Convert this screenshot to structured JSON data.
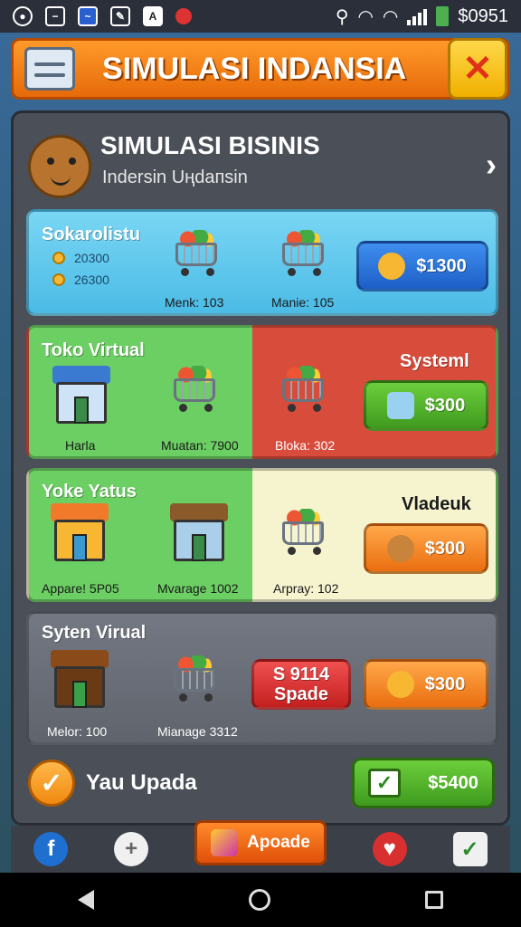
{
  "status": {
    "right_text": "$0951"
  },
  "header": {
    "title": "SIMULASI INDANSIA",
    "close_glyph": "✕"
  },
  "business": {
    "title": "SIMULASI BISINIS",
    "subtitle": "Indersin Uңdaпsin",
    "chevron": "›"
  },
  "cards": [
    {
      "title": "Sokarolistu",
      "values": [
        "20300",
        "26300"
      ],
      "item1_label": "Menk: 103",
      "item2_label": "Manie: 105",
      "price": "$1300"
    },
    {
      "title_left": "Toko Virtual",
      "title_right": "Systeml",
      "item1_label": "Harla",
      "item2_label": "Muatan: 7900",
      "item3_label": "Bloka: 302",
      "price": "$300"
    },
    {
      "title_left": "Yoke Yatus",
      "title_right": "Vladeuk",
      "item1_label": "Appare! 5P05",
      "item2_label": "Mvarage 1002",
      "item3_label": "Arpray: 102",
      "price": "$300"
    },
    {
      "title": "Syten Virual",
      "item1_label": "Melor: 100",
      "item2_label": "Mianage 3312",
      "red_line1": "S 9114",
      "red_line2": "Spade",
      "price": "$300"
    }
  ],
  "bottom": {
    "label": "Yau Upada",
    "check": "✓",
    "button_price": "$5400",
    "button_check": "✓"
  },
  "tabs": {
    "center_label": "Apoade",
    "fb": "f",
    "plus": "+",
    "heart": "♥",
    "bag": "✓"
  },
  "colors": {
    "header": "#ef7d1a",
    "card1": "#5ec8ee",
    "card_green": "#6ccf63",
    "card_red": "#d84c3c",
    "card_cream": "#f6f3cf",
    "card_gray": "#6a6f78"
  }
}
